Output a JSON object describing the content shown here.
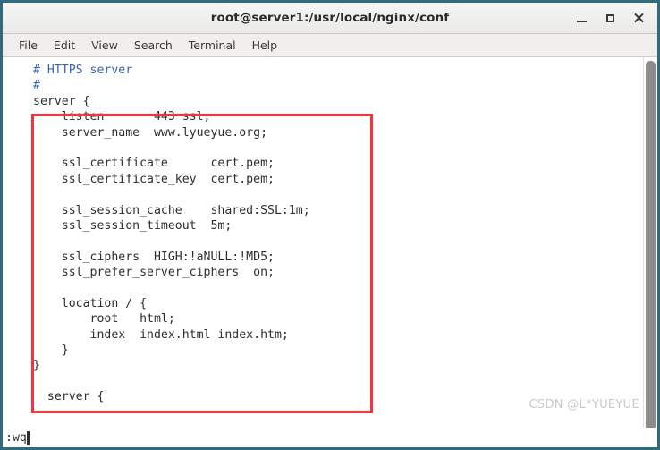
{
  "window": {
    "title": "root@server1:/usr/local/nginx/conf",
    "controls": [
      {
        "name": "minimize",
        "glyph": "_"
      },
      {
        "name": "maximize",
        "glyph": "□"
      },
      {
        "name": "close",
        "glyph": "✕"
      }
    ],
    "border_color": "#2f6b7a",
    "titlebar_color": "#f0efed"
  },
  "menubar": {
    "items": [
      {
        "label": "File"
      },
      {
        "label": "Edit"
      },
      {
        "label": "View"
      },
      {
        "label": "Search"
      },
      {
        "label": "Terminal"
      },
      {
        "label": "Help"
      }
    ]
  },
  "terminal": {
    "lines": [
      {
        "text": "# HTTPS server",
        "type": "comment"
      },
      {
        "text": "#",
        "type": "comment"
      },
      {
        "text": "server {",
        "type": "code"
      },
      {
        "text": "    listen       443 ssl;",
        "type": "code"
      },
      {
        "text": "    server_name  www.lyueyue.org;",
        "type": "code"
      },
      {
        "text": "",
        "type": "code"
      },
      {
        "text": "    ssl_certificate      cert.pem;",
        "type": "code"
      },
      {
        "text": "    ssl_certificate_key  cert.pem;",
        "type": "code"
      },
      {
        "text": "",
        "type": "code"
      },
      {
        "text": "    ssl_session_cache    shared:SSL:1m;",
        "type": "code"
      },
      {
        "text": "    ssl_session_timeout  5m;",
        "type": "code"
      },
      {
        "text": "",
        "type": "code"
      },
      {
        "text": "    ssl_ciphers  HIGH:!aNULL:!MD5;",
        "type": "code"
      },
      {
        "text": "    ssl_prefer_server_ciphers  on;",
        "type": "code"
      },
      {
        "text": "",
        "type": "code"
      },
      {
        "text": "    location / {",
        "type": "code"
      },
      {
        "text": "        root   html;",
        "type": "code"
      },
      {
        "text": "        index  index.html index.htm;",
        "type": "code"
      },
      {
        "text": "    }",
        "type": "code"
      },
      {
        "text": "}",
        "type": "code"
      },
      {
        "text": "",
        "type": "code"
      },
      {
        "text": "  server {",
        "type": "code"
      }
    ],
    "comment_color": "#3a64b0",
    "text_color": "#2e2e2e"
  },
  "annotation": {
    "highlight_color": "#f5333a"
  },
  "status": {
    "command": ":wq"
  },
  "watermark": {
    "text": "CSDN @L*YUEYUE"
  }
}
